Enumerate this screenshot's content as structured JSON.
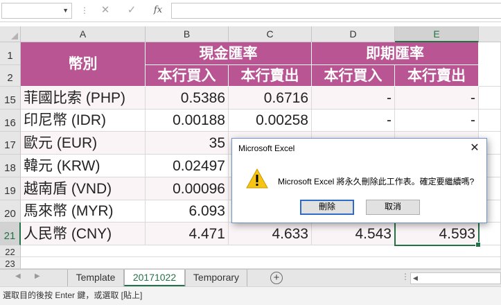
{
  "formula_bar": {
    "name_box": "",
    "cancel_icon": "close-icon",
    "enter_icon": "check-icon",
    "fx_label": "fx",
    "formula": ""
  },
  "columns": [
    "A",
    "B",
    "C",
    "D",
    "E"
  ],
  "selected_column": "E",
  "header": {
    "currency": "幣別",
    "cash_rate": "現金匯率",
    "spot_rate": "即期匯率",
    "bank_buy": "本行買入",
    "bank_sell": "本行賣出"
  },
  "row_numbers": [
    "1",
    "2",
    "15",
    "16",
    "17",
    "18",
    "19",
    "20",
    "21",
    "22",
    "23"
  ],
  "selected_row": "21",
  "rows": [
    {
      "row": "15",
      "currency": "菲國比索 (PHP)",
      "cash_buy": "0.5386",
      "cash_sell": "0.6716",
      "spot_buy": "-",
      "spot_sell": "-"
    },
    {
      "row": "16",
      "currency": "印尼幣 (IDR)",
      "cash_buy": "0.00188",
      "cash_sell": "0.00258",
      "spot_buy": "-",
      "spot_sell": "-"
    },
    {
      "row": "17",
      "currency": "歐元 (EUR)",
      "cash_buy": "35",
      "cash_sell": "",
      "spot_buy": "",
      "spot_sell": ""
    },
    {
      "row": "18",
      "currency": "韓元 (KRW)",
      "cash_buy": "0.02497",
      "cash_sell": "",
      "spot_buy": "",
      "spot_sell": ""
    },
    {
      "row": "19",
      "currency": "越南盾 (VND)",
      "cash_buy": "0.00096",
      "cash_sell": "",
      "spot_buy": "",
      "spot_sell": ""
    },
    {
      "row": "20",
      "currency": "馬來幣 (MYR)",
      "cash_buy": "6.093",
      "cash_sell": "",
      "spot_buy": "",
      "spot_sell": ""
    },
    {
      "row": "21",
      "currency": "人民幣 (CNY)",
      "cash_buy": "4.471",
      "cash_sell": "4.633",
      "spot_buy": "4.543",
      "spot_sell": "4.593"
    }
  ],
  "sheet_tabs": [
    {
      "label": "Template",
      "active": false
    },
    {
      "label": "20171022",
      "active": true
    },
    {
      "label": "Temporary",
      "active": false
    }
  ],
  "add_sheet_icon": "plus-circle-icon",
  "status_text": "選取目的後按 Enter 鍵，或選取 [貼上]",
  "dialog": {
    "title": "Microsoft Excel",
    "message": "Microsoft Excel 將永久刪除此工作表。確定要繼續嗎?",
    "icon": "warning-icon",
    "delete_label": "刪除",
    "cancel_label": "取消",
    "close_glyph": "✕"
  },
  "colors": {
    "header_fill": "#b85592",
    "stripe_fill": "#faf4f7",
    "excel_green": "#217346"
  }
}
